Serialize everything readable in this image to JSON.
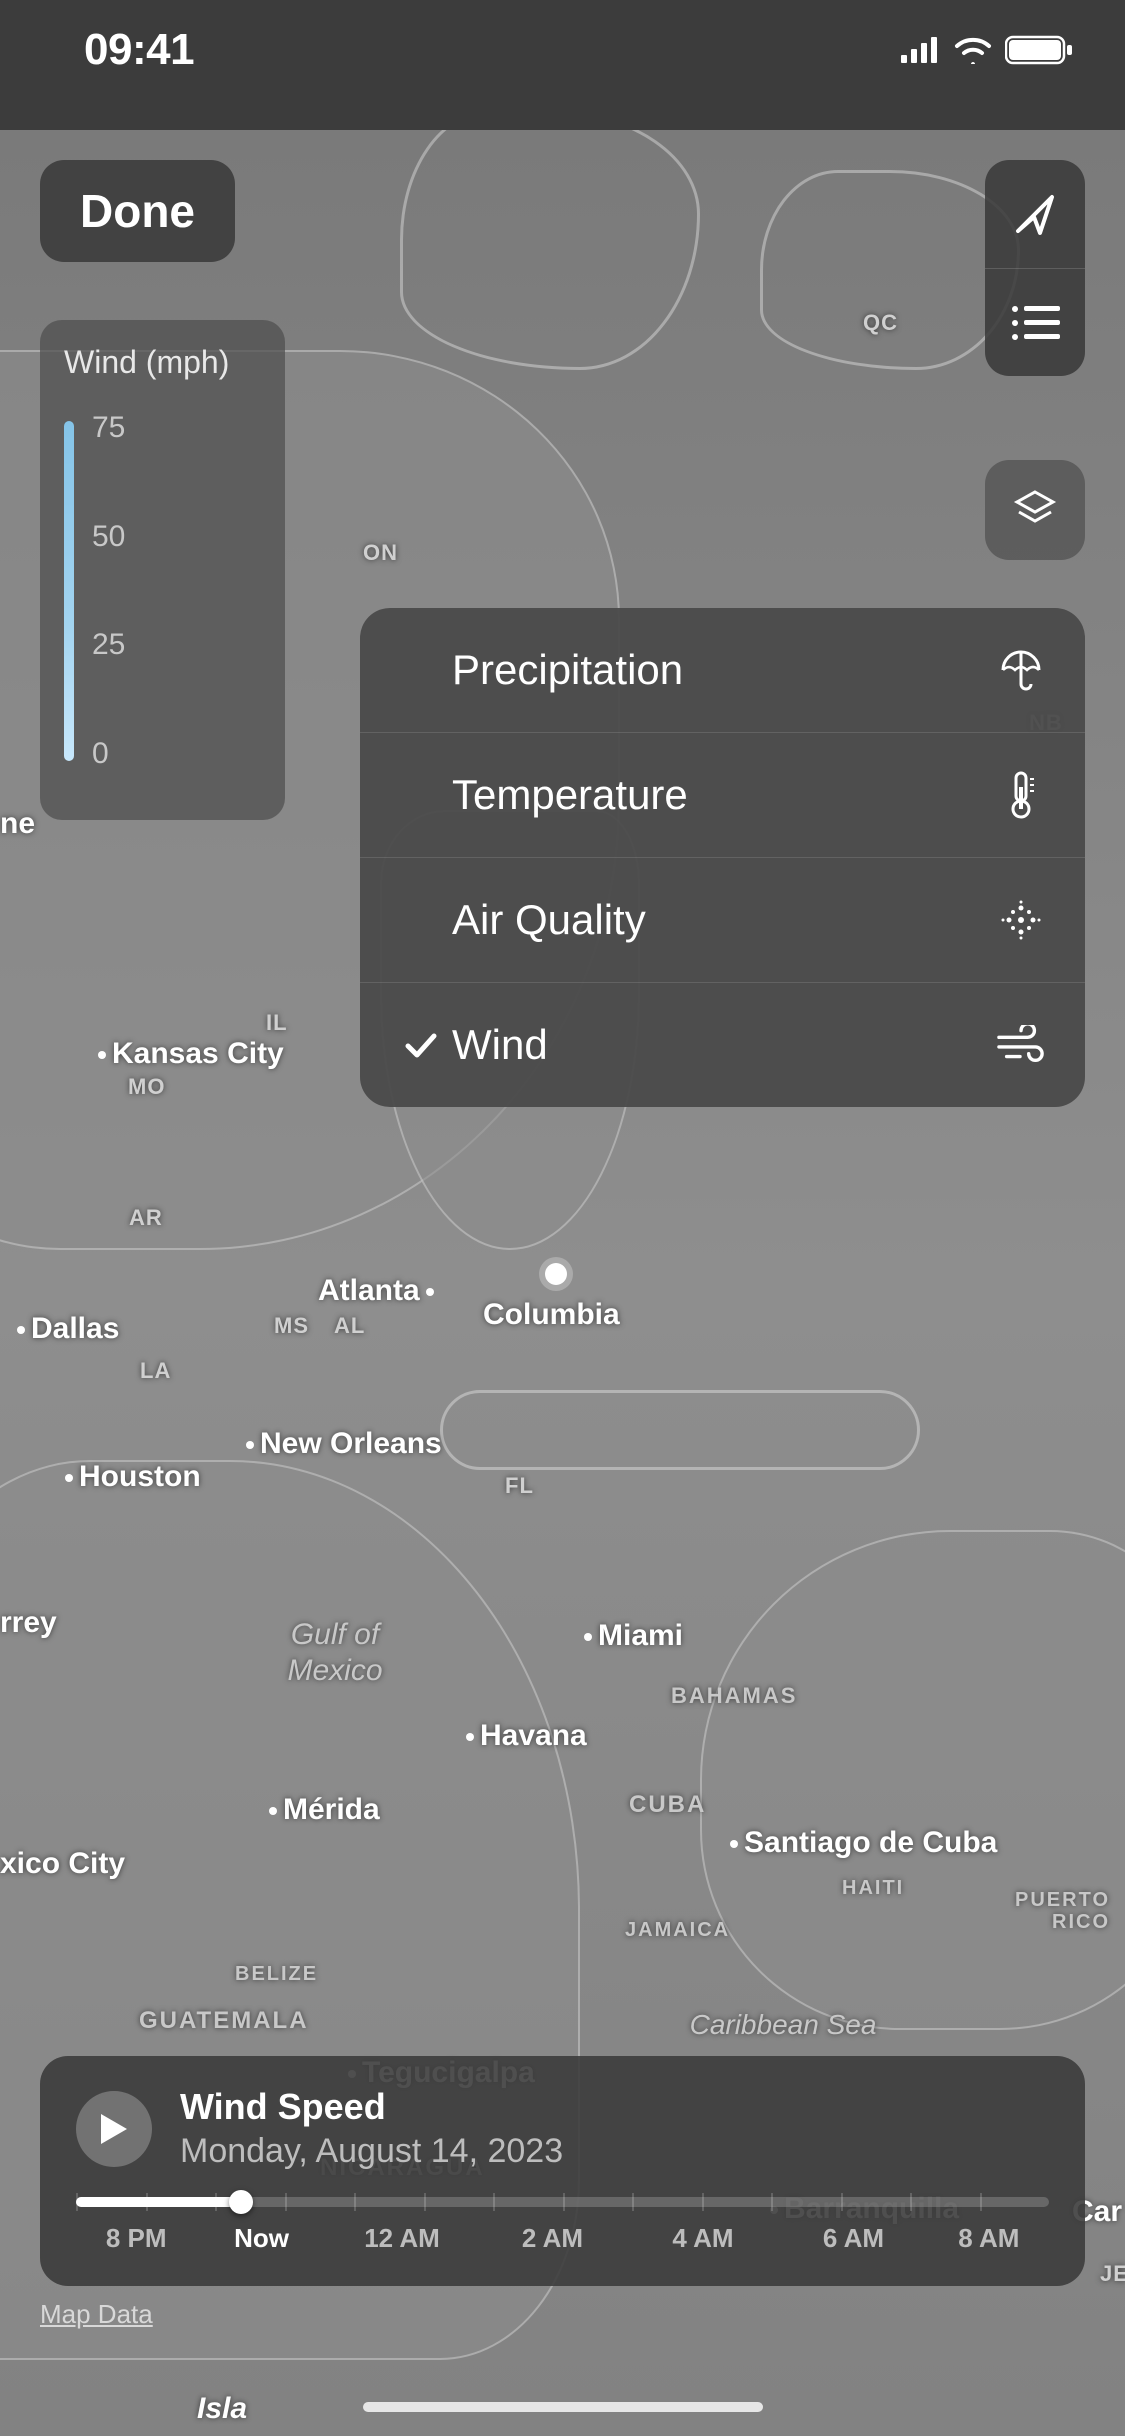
{
  "statusbar": {
    "time": "09:41"
  },
  "header": {
    "done_label": "Done"
  },
  "legend": {
    "title": "Wind (mph)",
    "ticks": [
      "75",
      "50",
      "25",
      "0"
    ]
  },
  "layer_menu": {
    "items": [
      {
        "label": "Precipitation",
        "icon": "umbrella-icon",
        "selected": false
      },
      {
        "label": "Temperature",
        "icon": "thermometer-icon",
        "selected": false
      },
      {
        "label": "Air Quality",
        "icon": "particles-icon",
        "selected": false
      },
      {
        "label": "Wind",
        "icon": "wind-icon",
        "selected": true
      }
    ]
  },
  "map_labels": {
    "regions_states": [
      "QC",
      "ON",
      "NB",
      "IL",
      "MO",
      "AR",
      "MS",
      "AL",
      "LA",
      "FL"
    ],
    "countries": [
      "BAHAMAS",
      "CUBA",
      "HAITI",
      "PUERTO RICO",
      "JAMAICA",
      "BELIZE",
      "GUATEMALA",
      "NICARAGUA"
    ],
    "cities": [
      "Kansas City",
      "Atlanta",
      "Columbia",
      "Dallas",
      "New Orleans",
      "Houston",
      "Miami",
      "Havana",
      "Mérida",
      "Santiago de Cuba",
      "Tegucigalpa",
      "Barranquilla"
    ],
    "partial": [
      "ne",
      "rrey",
      "xico City",
      "Car",
      "Isla",
      "JE"
    ],
    "water": [
      "Gulf of Mexico",
      "Caribbean Sea"
    ]
  },
  "timeline": {
    "title": "Wind Speed",
    "subtitle": "Monday, August 14, 2023",
    "labels": [
      "8 PM",
      "Now",
      "12 AM",
      "2 AM",
      "4 AM",
      "6 AM",
      "8 AM"
    ]
  },
  "footer": {
    "map_data_label": "Map Data"
  }
}
